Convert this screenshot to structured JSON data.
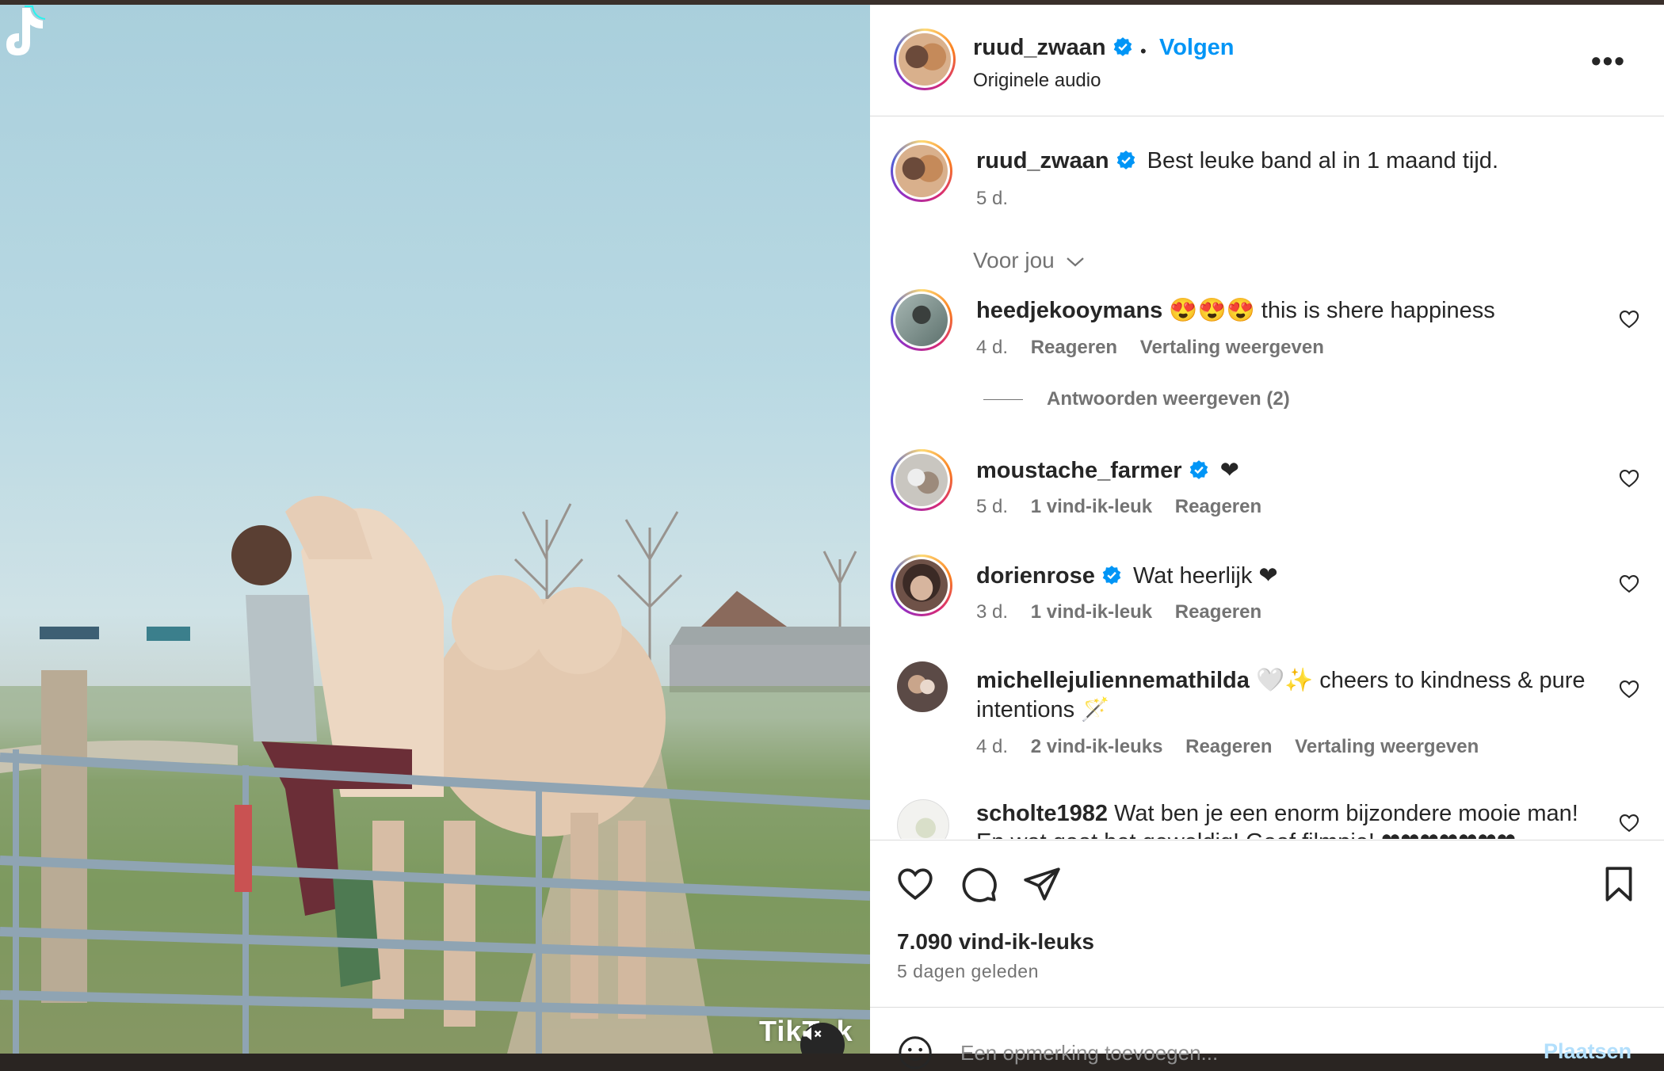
{
  "post": {
    "author": "ruud_zwaan",
    "follow_label": "Volgen",
    "separator": "•",
    "audio_label": "Originele audio",
    "more_label": "•••"
  },
  "caption": {
    "username": "ruud_zwaan",
    "text": "Best leuke band al in 1 maand tijd.",
    "time": "5 d."
  },
  "filter_label": "Voor jou",
  "comments": [
    {
      "username": "heedjekooymans",
      "text": "😍😍😍 this is shere happiness",
      "time": "4 d.",
      "likes": "",
      "reply": "Reageren",
      "translate": "Vertaling weergeven",
      "verified": false
    },
    {
      "username": "moustache_farmer",
      "text": "❤",
      "time": "5 d.",
      "likes": "1 vind-ik-leuk",
      "reply": "Reageren",
      "translate": "",
      "verified": true
    },
    {
      "username": "dorienrose",
      "text": "Wat heerlijk ❤",
      "time": "3 d.",
      "likes": "1 vind-ik-leuk",
      "reply": "Reageren",
      "translate": "",
      "verified": true
    },
    {
      "username": "michellejuliennemathilda",
      "text": "🤍✨ cheers to kindness & pure",
      "text2": "intentions 🪄",
      "time": "4 d.",
      "likes": "2 vind-ik-leuks",
      "reply": "Reageren",
      "translate": "Vertaling weergeven",
      "verified": false
    },
    {
      "username": "scholte1982",
      "text": "Wat ben je een enorm bijzondere mooie man!",
      "text2": "En wat gaat het geweldig! Gaaf filmpje! ❤❤❤❤❤❤❤",
      "verified": false
    }
  ],
  "view_replies": "Antwoorden weergeven (2)",
  "likes_count": "7.090 vind-ik-leuks",
  "posted_ago": "5 dagen geleden",
  "add_comment_placeholder": "Een opmerking toevoegen...",
  "post_button": "Plaatsen",
  "media": {
    "watermark": "TikTok"
  },
  "colors": {
    "accent": "#0095f6",
    "verified": "#0095f6",
    "muted": "#737373"
  }
}
